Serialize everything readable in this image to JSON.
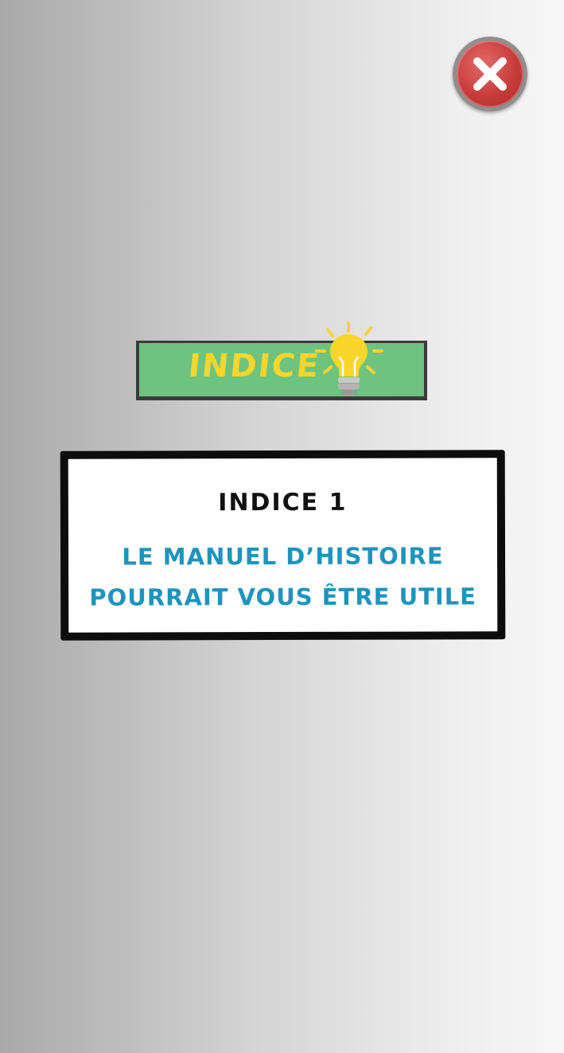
{
  "close": {
    "icon": "close-icon",
    "color": "#c93b3b"
  },
  "banner": {
    "title": "INDICE",
    "icon": "lightbulb-icon",
    "background": "#6ec37f",
    "title_color": "#f9d62d"
  },
  "hint": {
    "title": "INDICE 1",
    "line1": "LE MANUEL D’HISTOIRE",
    "line2": "POURRAIT VOUS ÊTRE UTILE",
    "text_color": "#1e94bd"
  }
}
